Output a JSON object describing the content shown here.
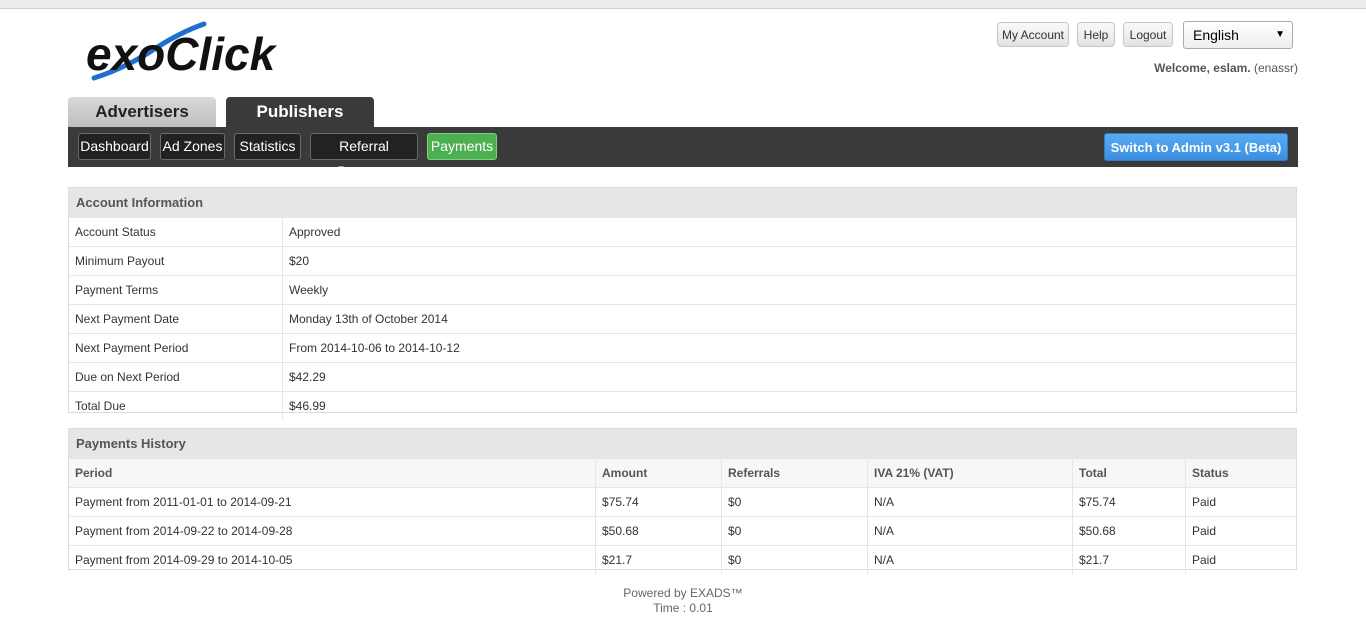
{
  "header": {
    "logo_text": "exoClick",
    "my_account": "My Account",
    "help": "Help",
    "logout": "Logout",
    "language": "English",
    "welcome_label": "Welcome, eslam.",
    "welcome_user": "(enassr)"
  },
  "tabs": {
    "advertisers": "Advertisers",
    "publishers": "Publishers"
  },
  "nav": {
    "items": [
      "Dashboard",
      "Ad Zones",
      "Statistics",
      "Referral Program",
      "Payments"
    ],
    "admin": "Switch to Admin v3.1 (Beta)"
  },
  "account": {
    "title": "Account Information",
    "rows": [
      [
        "Account Status",
        "Approved"
      ],
      [
        "Minimum Payout",
        "$20"
      ],
      [
        "Payment Terms",
        "Weekly"
      ],
      [
        "Next Payment Date",
        "Monday 13th of October 2014"
      ],
      [
        "Next Payment Period",
        "From 2014-10-06 to 2014-10-12"
      ],
      [
        "Due on Next Period",
        "$42.29"
      ],
      [
        "Total Due",
        "$46.99"
      ]
    ]
  },
  "history": {
    "title": "Payments History",
    "columns": [
      "Period",
      "Amount",
      "Referrals",
      "IVA 21% (VAT)",
      "Total",
      "Status"
    ],
    "rows": [
      [
        "Payment from 2011-01-01 to 2014-09-21",
        "$75.74",
        "$0",
        "N/A",
        "$75.74",
        "Paid"
      ],
      [
        "Payment from 2014-09-22 to 2014-09-28",
        "$50.68",
        "$0",
        "N/A",
        "$50.68",
        "Paid"
      ],
      [
        "Payment from 2014-09-29 to 2014-10-05",
        "$21.7",
        "$0",
        "N/A",
        "$21.7",
        "Paid"
      ]
    ]
  },
  "footer": {
    "powered": "Powered by EXADS™",
    "time": "Time : 0.01"
  },
  "colors": {
    "accent_green": "#4caf50",
    "admin_blue": "#3b8fe0",
    "logo_blue": "#1e6fd0"
  }
}
